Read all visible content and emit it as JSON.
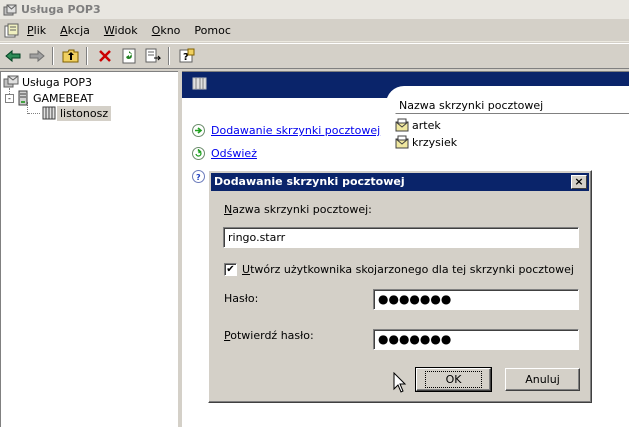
{
  "window": {
    "title": "Usługa POP3"
  },
  "menu": [
    "Plik",
    "Akcja",
    "Widok",
    "Okno",
    "Pomoc"
  ],
  "toolbar": {
    "icons": [
      "back-arrow-icon",
      "forward-arrow-icon",
      "up-folder-icon",
      "delete-icon",
      "refresh-icon",
      "export-list-icon",
      "help-icon"
    ],
    "colors": {
      "delete": "#cc0000",
      "arrows": "#008080"
    }
  },
  "tree": {
    "root": "Usługa POP3",
    "server": "GAMEBEAT",
    "server_expander": "-",
    "domain": "listonosz"
  },
  "tasks": {
    "add_mailbox": "Dodawanie skrzynki pocztowej",
    "refresh": "Odśwież"
  },
  "list": {
    "header": "Nazwa skrzynki pocztowej",
    "items": [
      "artek",
      "krzysiek"
    ]
  },
  "dialog": {
    "title": "Dodawanie skrzynki pocztowej",
    "close_glyph": "×",
    "mailbox_label": "Nazwa skrzynki pocztowej:",
    "mailbox_value": "ringo.starr",
    "checkbox_label": "Utwórz użytkownika skojarzonego dla tej skrzynki pocztowej",
    "checkbox_checked": true,
    "checkbox_glyph": "✔",
    "password_label": "Hasło:",
    "password_value": "●●●●●●●",
    "confirm_label": "Potwierdź hasło:",
    "confirm_value": "●●●●●●●",
    "ok_label": "OK",
    "cancel_label": "Anuluj"
  },
  "colors": {
    "banner": "#0a246a",
    "title_active": "#0a246a",
    "link": "#0000ee"
  }
}
